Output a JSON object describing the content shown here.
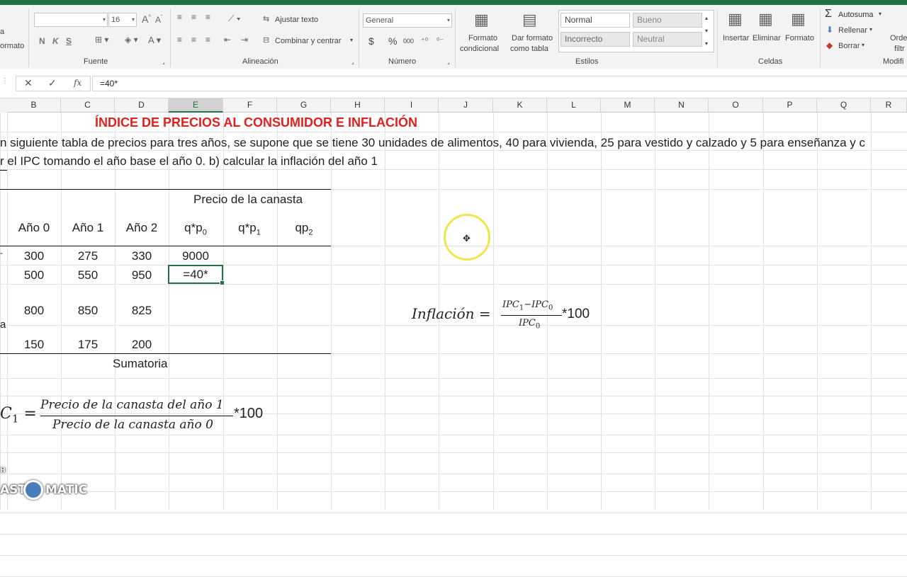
{
  "ribbon": {
    "font_size": "16",
    "font_buttons": [
      "N",
      "K",
      "S"
    ],
    "font_group": "Fuente",
    "wrap_text": "Ajustar texto",
    "merge_center": "Combinar y centrar",
    "alignment_group": "Alineación",
    "number_format": "General",
    "number_group": "Número",
    "currency_symbol": "$",
    "percent_symbol": "%",
    "thousands_symbol": "000",
    "conditional_format_1": "Formato",
    "conditional_format_2": "condicional",
    "format_table_1": "Dar formato",
    "format_table_2": "como tabla",
    "styles": [
      "Normal",
      "Bueno",
      "Incorrecto",
      "Neutral"
    ],
    "styles_group": "Estilos",
    "insert": "Insertar",
    "delete": "Eliminar",
    "format": "Formato",
    "cells_group": "Celdas",
    "autosum": "Autosuma",
    "fill": "Rellenar",
    "clear": "Borrar",
    "sort_filter_1": "Orde",
    "sort_filter_2": "filtr",
    "modify_group": "Modifi",
    "left_cut_label": "ormato",
    "left_cut_icon": "a"
  },
  "formula_bar": {
    "cancel": "✕",
    "enter": "✓",
    "fx": "fx",
    "content": "=40*"
  },
  "columns": [
    "B",
    "C",
    "D",
    "E",
    "F",
    "G",
    "H",
    "I",
    "J",
    "K",
    "L",
    "M",
    "N",
    "O",
    "P",
    "Q",
    "R"
  ],
  "selected_column": "E",
  "sheet": {
    "title": "ÍNDICE DE PRECIOS AL CONSUMIDOR E INFLACIÓN",
    "line1": "n siguiente tabla de precios para tres años, se supone que se tiene 30 unidades de alimentos, 40 para vivienda, 25 para vestido y calzado y 5 para enseñanza y c",
    "line2": "r el IPC tomando el año base el año 0. b) calcular la inflación del año 1",
    "precio_canasta": "Precio de la canasta",
    "headers": {
      "year0": "Año 0",
      "year1": "Año 1",
      "year2": "Año 2",
      "qp0_base": "q*p",
      "qp0_sub": "0",
      "qp1_base": "q*p",
      "qp1_sub": "1",
      "qp2_base": "qp",
      "qp2_sub": "2"
    },
    "rows": [
      {
        "b": "300",
        "c": "275",
        "d": "330",
        "e": "9000",
        "left": "-"
      },
      {
        "b": "500",
        "c": "550",
        "d": "950",
        "e": "=40*",
        "left": ""
      },
      {
        "b": "800",
        "c": "850",
        "d": "825",
        "e": "",
        "left": ""
      },
      {
        "b": "150",
        "c": "175",
        "d": "200",
        "e": "",
        "left": ""
      }
    ],
    "left_char_row3": "a",
    "sumatoria": "Sumatoria"
  },
  "formula_ipc": {
    "lhs": "C",
    "lhs_sub": "1",
    "numerator": "Precio de la canasta del año 1",
    "denominator": "Precio de la canasta año 0",
    "mult": "*100"
  },
  "formula_inflation": {
    "lhs": "Inflación",
    "num_a": "IPC",
    "num_a_sub": "1",
    "minus": "−",
    "num_b": "IPC",
    "num_b_sub": "0",
    "den": "IPC",
    "den_sub": "0",
    "mult": "*100"
  },
  "watermark": {
    "left": "AST",
    "right": "MATIC",
    "top": "H"
  },
  "colors": {
    "excel_green": "#217346",
    "title_red": "#e0211d",
    "cursor_yellow": "#f0e64b"
  }
}
